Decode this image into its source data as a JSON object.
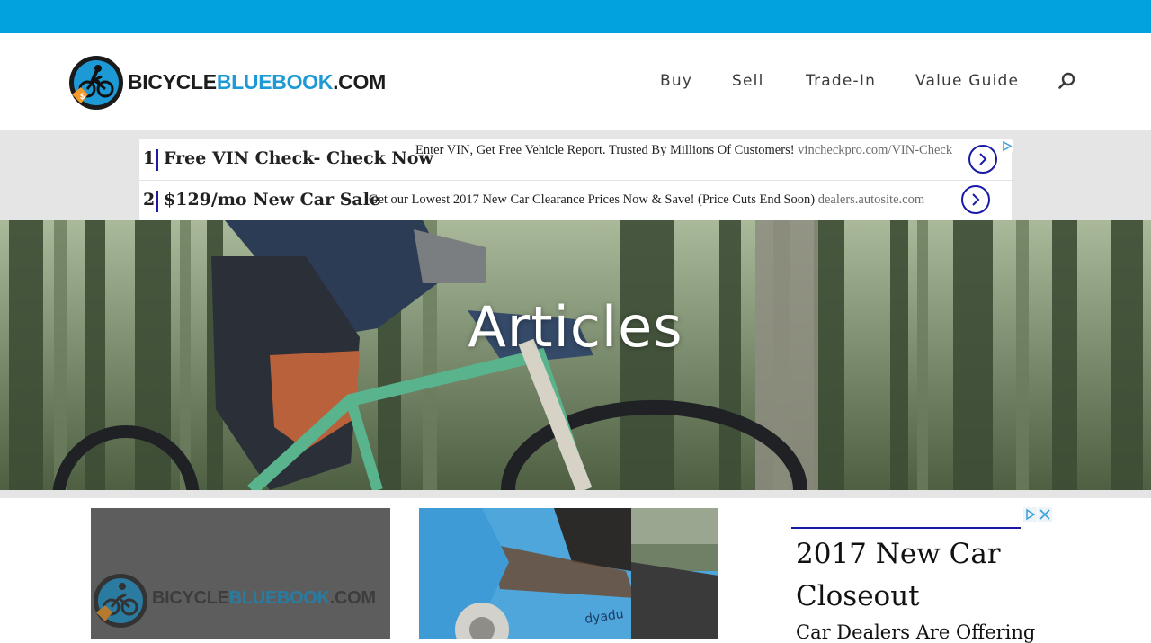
{
  "colors": {
    "topbar": "#00a3dd",
    "brand_blue": "#1d9ad6",
    "ad_accent": "#1a1aa6",
    "ad_band": "#e5e5e5"
  },
  "header": {
    "logo": {
      "text_dark": "BICYCLE",
      "text_blue": "BLUEBOOK",
      "text_suffix": ".COM",
      "icon": "cyclist-logo-icon"
    },
    "nav": [
      {
        "label": "Buy"
      },
      {
        "label": "Sell"
      },
      {
        "label": "Trade-In"
      },
      {
        "label": "Value Guide"
      }
    ],
    "search_icon": "search-icon"
  },
  "ads": [
    {
      "num": "1",
      "title": "Free VIN Check- Check Now",
      "desc": "Enter VIN, Get Free Vehicle Report. Trusted By Millions Of Customers!",
      "url": "vincheckpro.com/VIN-Check"
    },
    {
      "num": "2",
      "title": "$129/mo New Car Sale",
      "desc": "Get our Lowest 2017 New Car Clearance Prices Now & Save! (Price Cuts End Soon)",
      "url": "dealers.autosite.com"
    }
  ],
  "hero": {
    "title": "Articles"
  },
  "cards": [
    {
      "kind": "placeholder-logo",
      "logo": {
        "text_dark": "BICYCLE",
        "text_blue": "BLUEBOOK",
        "text_suffix": ".COM"
      }
    },
    {
      "kind": "photo",
      "brand_text": "dyadu"
    }
  ],
  "side_ad": {
    "title": "2017 New Car Closeout",
    "text": "Car Dealers Are Offering"
  }
}
